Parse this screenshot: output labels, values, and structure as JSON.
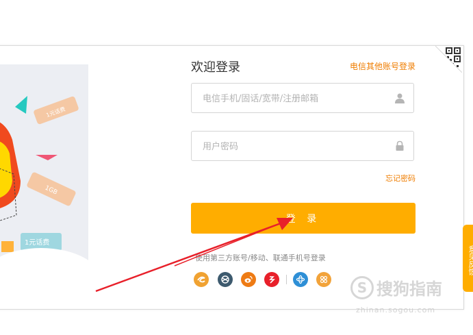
{
  "login": {
    "title": "欢迎登录",
    "other_login_link": "电信其他账号登录",
    "username_placeholder": "电信手机/固话/宽带/注册邮箱",
    "password_placeholder": "用户密码",
    "forgot_password": "忘记密码",
    "submit_label": "登 录",
    "third_party_title": "使用第三方账号/移动、联通手机号登录"
  },
  "social_logins": [
    {
      "icon": "tianyi-icon",
      "color": "#f0a232"
    },
    {
      "icon": "alipay-icon",
      "color": "#3d5a6e"
    },
    {
      "icon": "weibo-icon",
      "color": "#ee7b14"
    },
    {
      "icon": "yixin-icon",
      "color": "#e8202a"
    },
    {
      "icon": "china-mobile-icon",
      "color": "#2e8fd6"
    },
    {
      "icon": "china-unicom-icon",
      "color": "#f2a33a"
    }
  ],
  "banner": {
    "coupon_1": "1元话费",
    "coupon_2": "1GB",
    "coupon_3": "1元话费"
  },
  "side_tab": {
    "label": "意见反馈"
  },
  "watermark": {
    "text": "搜狗指南",
    "logo_letter": "S",
    "url": "zhinan.sogou.com"
  },
  "colors": {
    "accent": "#ffad00",
    "link": "#ef7d00",
    "arrow": "#e8202a"
  }
}
